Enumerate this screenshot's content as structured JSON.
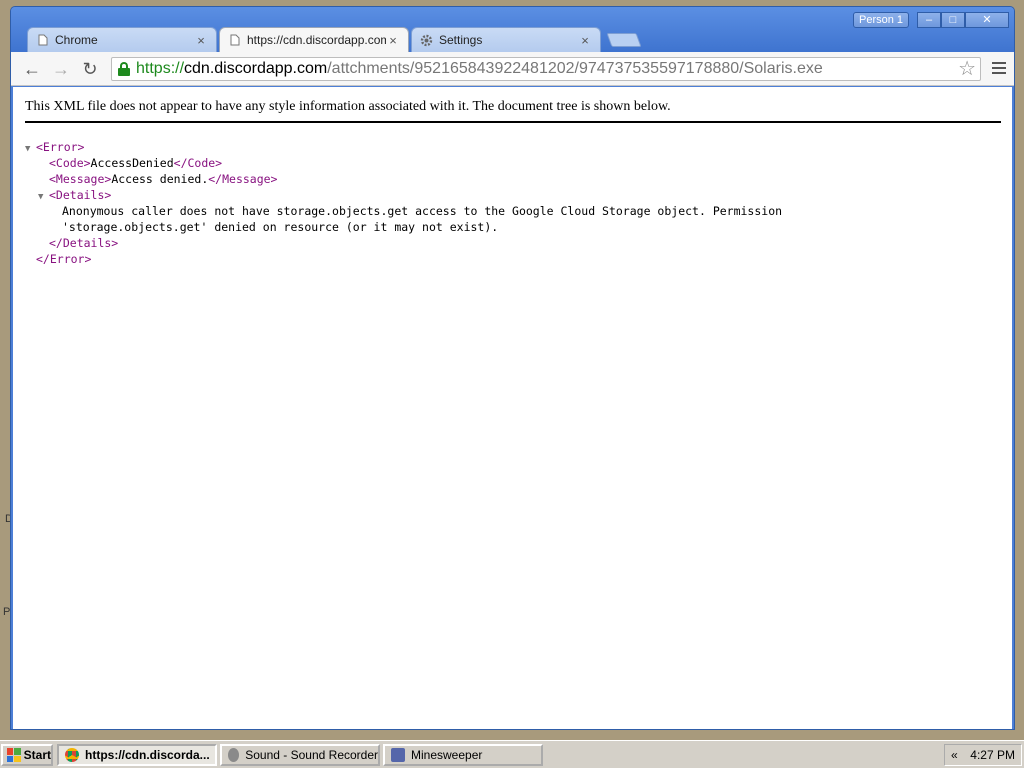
{
  "desktop": {
    "glyph_1": "D",
    "glyph_2": "P"
  },
  "window": {
    "tabs": [
      {
        "label": "Chrome",
        "icon": "page-icon",
        "close": "×"
      },
      {
        "label": "https://cdn.discordapp.com/",
        "icon": "page-icon",
        "close": "×"
      },
      {
        "label": "Settings",
        "icon": "gear-icon",
        "close": "×"
      }
    ],
    "profile": "Person 1",
    "controls": {
      "minimize": "–",
      "maximize": "□",
      "close": "✕"
    }
  },
  "toolbar": {
    "back": "←",
    "forward": "→",
    "reload": "↻",
    "url_scheme": "https://",
    "url_host": "cdn.discordapp.com",
    "url_path": "/attchments/952165843922481202/974737535597178880/Solaris.exe",
    "bookmark": "☆"
  },
  "page": {
    "notice": "This XML file does not appear to have any style information associated with it. The document tree is shown below.",
    "xml": {
      "error_open": "<Error>",
      "code_open": "<Code>",
      "code_value": "AccessDenied",
      "code_close": "</Code>",
      "message_open": "<Message>",
      "message_value": "Access denied.",
      "message_close": "</Message>",
      "details_open": "<Details>",
      "details_line1": "Anonymous caller does not have storage.objects.get access to the Google Cloud Storage object. Permission",
      "details_line2": "'storage.objects.get' denied on resource (or it may not exist).",
      "details_close": "</Details>",
      "error_close": "</Error>",
      "toggle": "▼"
    }
  },
  "taskbar": {
    "start": "Start",
    "tasks": [
      {
        "label": "https://cdn.discorda...",
        "icon": "chrome-icon"
      },
      {
        "label": "Sound - Sound Recorder",
        "icon": "microphone-icon"
      },
      {
        "label": "Minesweeper",
        "icon": "mine-icon"
      }
    ],
    "tray_arrows": "«",
    "clock": "4:27 PM"
  }
}
